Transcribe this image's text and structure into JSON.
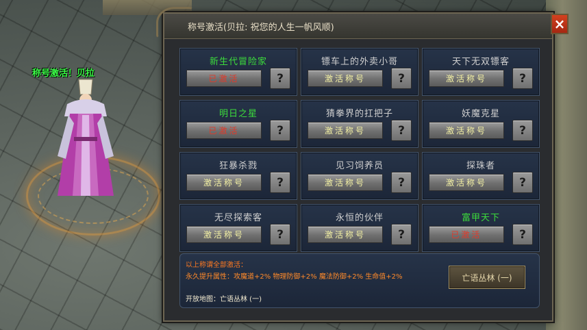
{
  "character": {
    "title_label": "称号激活！贝拉"
  },
  "panel": {
    "title": "称号激活(贝拉: 祝您的人生一帆风顺)",
    "close_icon": "×"
  },
  "titles": [
    {
      "name": "新生代冒险家",
      "button": "已激活",
      "active": true
    },
    {
      "name": "镖车上的外卖小哥",
      "button": "激活称号",
      "active": false
    },
    {
      "name": "天下无双镖客",
      "button": "激活称号",
      "active": false
    },
    {
      "name": "明日之星",
      "button": "已激活",
      "active": true
    },
    {
      "name": "猜拳界的扛把子",
      "button": "激活称号",
      "active": false
    },
    {
      "name": "妖魔克星",
      "button": "激活称号",
      "active": false
    },
    {
      "name": "狂暴杀戮",
      "button": "激活称号",
      "active": false
    },
    {
      "name": "见习饲养员",
      "button": "激活称号",
      "active": false
    },
    {
      "name": "探珠者",
      "button": "激活称号",
      "active": false
    },
    {
      "name": "无尽探索客",
      "button": "激活称号",
      "active": false
    },
    {
      "name": "永恒的伙伴",
      "button": "激活称号",
      "active": false
    },
    {
      "name": "富甲天下",
      "button": "已激活",
      "active": true
    }
  ],
  "help_label": "?",
  "bonus": {
    "heading": "以上称谓全部激活：",
    "effect": "永久提升属性：攻魔道+2% 物理防御+2% 魔法防御+2% 生命值+2%",
    "map_text": "开放地图：亡语丛林 (一)",
    "map_button": "亡语丛林 (一)"
  },
  "colors": {
    "active_name": "#3cdc3c",
    "inactive_name": "#cfcfcf",
    "activated_btn_text": "#e03a2a",
    "activate_btn_text": "#f4f1a4",
    "bonus_text": "#ff8a2a"
  }
}
